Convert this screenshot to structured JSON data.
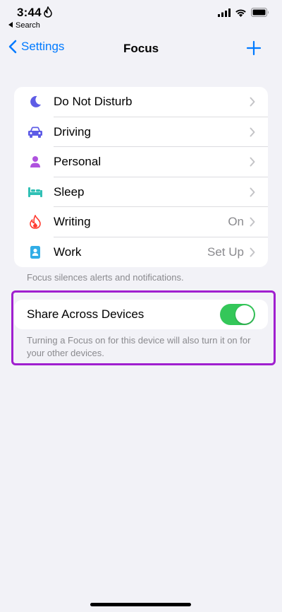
{
  "status_bar": {
    "time": "3:44",
    "back_app_label": "Search",
    "icons": [
      "focus-flame-icon",
      "cellular-signal-icon",
      "wifi-icon",
      "battery-icon"
    ]
  },
  "nav": {
    "back_label": "Settings",
    "title": "Focus",
    "add_icon": "plus-icon"
  },
  "focus_list": {
    "items": [
      {
        "label": "Do Not Disturb",
        "value": "",
        "icon": "moon-icon",
        "color": "#5e5ce6"
      },
      {
        "label": "Driving",
        "value": "",
        "icon": "car-icon",
        "color": "#5e5ce6"
      },
      {
        "label": "Personal",
        "value": "",
        "icon": "person-icon",
        "color": "#af52de"
      },
      {
        "label": "Sleep",
        "value": "",
        "icon": "bed-icon",
        "color": "#30c0b5"
      },
      {
        "label": "Writing",
        "value": "On",
        "icon": "flame-icon",
        "color": "#ff3b30"
      },
      {
        "label": "Work",
        "value": "Set Up",
        "icon": "id-badge-icon",
        "color": "#32ade6"
      }
    ],
    "footnote": "Focus silences alerts and notifications."
  },
  "share": {
    "label": "Share Across Devices",
    "toggle_on": true,
    "footnote": "Turning a Focus on for this device will also turn it on for your other devices."
  },
  "colors": {
    "accent": "#007aff",
    "toggle_on": "#34c759",
    "highlight": "#a01fcf",
    "background": "#f2f2f7"
  }
}
